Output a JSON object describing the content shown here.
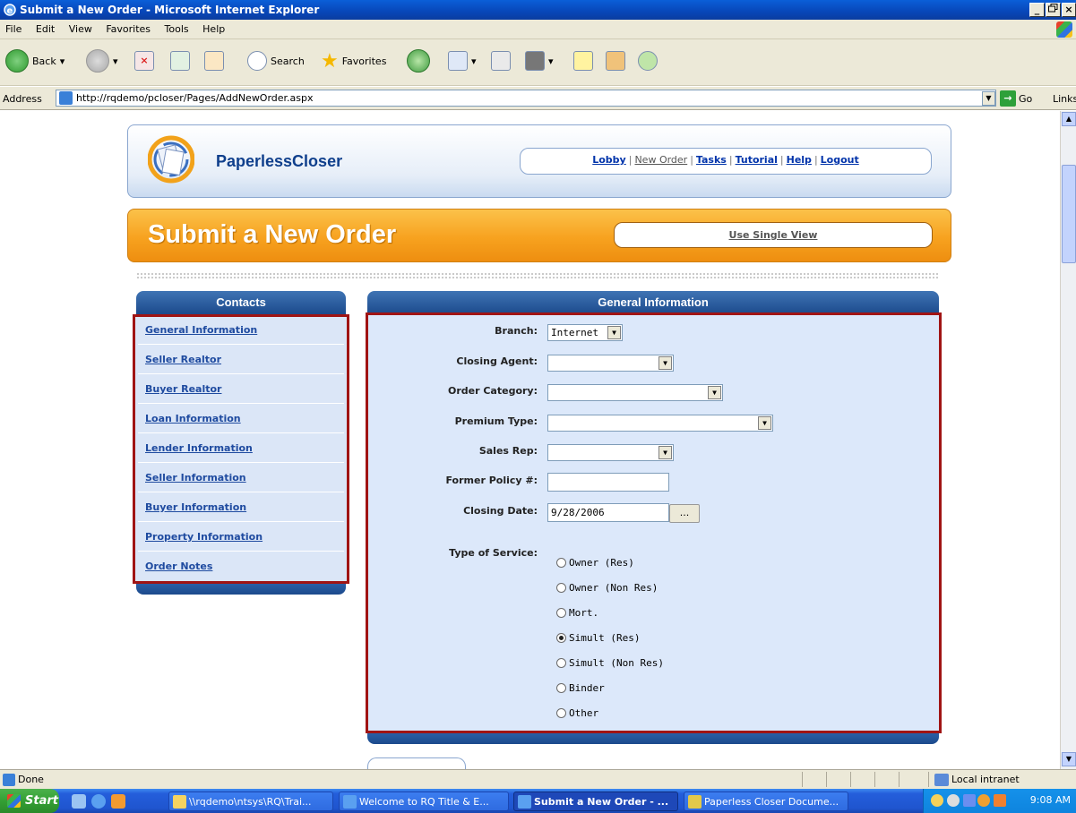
{
  "window": {
    "title": "Submit a New Order - Microsoft Internet Explorer",
    "buttons": [
      "_",
      " ",
      "×"
    ]
  },
  "menu": [
    "File",
    "Edit",
    "View",
    "Favorites",
    "Tools",
    "Help"
  ],
  "toolbar": {
    "back_label": "Back",
    "search_label": "Search",
    "favorites_label": "Favorites"
  },
  "address": {
    "label": "Address",
    "url": "http://rqdemo/pcloser/Pages/AddNewOrder.aspx",
    "go_label": "Go",
    "links_label": "Links"
  },
  "header": {
    "logo_text": "PaperlessCloser",
    "nav": [
      "Lobby",
      "New Order",
      "Tasks",
      "Tutorial",
      "Help",
      "Logout"
    ],
    "nav_separator": "|",
    "current_nav": "New Order"
  },
  "banner": {
    "title": "Submit a New Order",
    "single_view": "Use Single View"
  },
  "contacts": {
    "heading": "Contacts",
    "items": [
      "General Information",
      "Seller Realtor",
      "Buyer Realtor",
      "Loan Information",
      "Lender Information",
      "Seller Information",
      "Buyer Information",
      "Property Information",
      "Order Notes"
    ]
  },
  "general": {
    "heading": "General Information",
    "branch_label": "Branch:",
    "branch_value": "Internet",
    "closing_agent_label": "Closing Agent:",
    "closing_agent_value": "",
    "order_category_label": "Order Category:",
    "order_category_value": "",
    "premium_type_label": "Premium Type:",
    "premium_type_value": "",
    "sales_rep_label": "Sales Rep:",
    "sales_rep_value": "",
    "former_policy_label": "Former Policy #:",
    "former_policy_value": "",
    "closing_date_label": "Closing Date:",
    "closing_date_value": "9/28/2006",
    "calendar_button": "...",
    "type_of_service_label": "Type of Service:",
    "service_options": [
      "Owner (Res)",
      "Owner (Non Res)",
      "Mort.",
      "Simult (Res)",
      "Simult (Non Res)",
      "Binder",
      "Other"
    ],
    "service_selected": "Simult (Res)"
  },
  "status": {
    "text": "Done",
    "zone": "Local intranet"
  },
  "taskbar": {
    "start": "Start",
    "tasks": [
      "\\\\rqdemo\\ntsys\\RQ\\Trai...",
      "Welcome to RQ Title & E...",
      "Submit a New Order - ...",
      "Paperless Closer Docume..."
    ],
    "active_task": "Submit a New Order - ...",
    "clock": "9:08 AM"
  },
  "colors": {
    "highlight_border": "#a01414",
    "panel_header": "#1c4a8c",
    "banner_orange": "#f7a21f",
    "link_blue": "#1f4ba0"
  }
}
